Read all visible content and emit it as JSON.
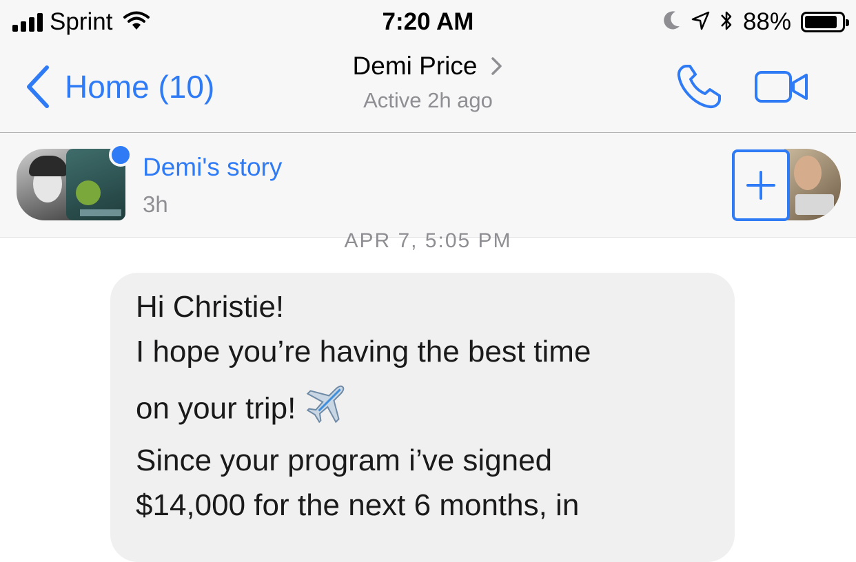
{
  "status_bar": {
    "carrier": "Sprint",
    "time": "7:20 AM",
    "battery_percent": "88%",
    "battery_level": 0.88,
    "icons": [
      "signal-bars-icon",
      "wifi-icon",
      "moon-icon",
      "location-arrow-icon",
      "bluetooth-icon",
      "battery-icon"
    ]
  },
  "nav": {
    "back_label": "Home (10)",
    "contact_name": "Demi Price",
    "status": "Active 2h ago",
    "actions": [
      "phone-icon",
      "video-camera-icon"
    ]
  },
  "story": {
    "title": "Demi's story",
    "time": "3h",
    "add_icon": "plus-icon"
  },
  "conversation": {
    "timestamp": "APR 7, 5:05 PM",
    "message_lines": [
      "Hi Christie!",
      "I hope you’re having the best time",
      "on your trip!",
      "Since your program i’ve signed",
      "$14,000 for the next 6 months, in"
    ],
    "emoji_icon": "airplane-icon"
  },
  "colors": {
    "accent": "#2f7bf5",
    "bar_background": "#f7f7f7",
    "bubble_background": "#f1f0f0",
    "secondary_text": "#8e8e93"
  }
}
